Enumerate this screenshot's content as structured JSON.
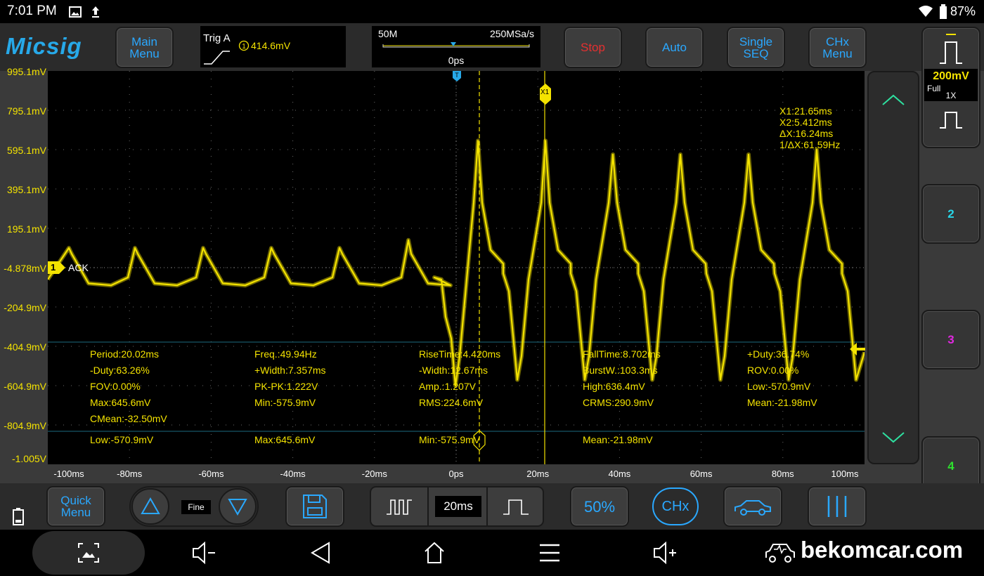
{
  "status": {
    "time": "7:01 PM",
    "battery": "87%"
  },
  "brand": "Micsig",
  "buttons": {
    "main_menu": [
      "Main",
      "Menu"
    ],
    "stop": "Stop",
    "auto": "Auto",
    "single_seq": [
      "Single",
      "SEQ"
    ],
    "chx_menu": [
      "CHx",
      "Menu"
    ],
    "quick_menu": [
      "Quick",
      "Menu"
    ],
    "fine": "Fine",
    "timebase": "20ms",
    "fifty_pct": "50%",
    "chx": "CHx"
  },
  "trigger": {
    "title": "Trig A",
    "level": "414.6mV"
  },
  "acquisition": {
    "memory": "50M",
    "sample_rate": "250MSa/s",
    "position": "0ps"
  },
  "channel": {
    "number": "1",
    "label": "ACK",
    "scale": "200mV",
    "bandwidth": "Full",
    "probe": "1X"
  },
  "side_channels": [
    "2",
    "3",
    "4"
  ],
  "colors": {
    "ch1": "#f4e300",
    "ch2": "#28d6e8",
    "ch3": "#e028e0",
    "ch4": "#2ee02e",
    "accent": "#2aa8ff"
  },
  "y_labels": [
    "995.1mV",
    "795.1mV",
    "595.1mV",
    "395.1mV",
    "195.1mV",
    "-4.878mV",
    "-204.9mV",
    "-404.9mV",
    "-604.9mV",
    "-804.9mV",
    "-1.005V"
  ],
  "x_labels": [
    "-100ms",
    "-80ms",
    "-60ms",
    "-40ms",
    "-20ms",
    "0ps",
    "20ms",
    "40ms",
    "60ms",
    "80ms",
    "100ms"
  ],
  "cursors": {
    "x1": "X1:21.65ms",
    "x2": "X2:5.412ms",
    "dx": "ΔX:16.24ms",
    "inv_dx": "1/ΔX:61.59Hz",
    "x1_tag": "X1"
  },
  "measurements": [
    [
      "Period:20.02ms",
      "-Duty:63.26%",
      "FOV:0.00%",
      "Max:645.6mV",
      "CMean:-32.50mV"
    ],
    [
      "Freq.:49.94Hz",
      "+Width:7.357ms",
      "PK-PK:1.222V",
      "Min:-575.9mV"
    ],
    [
      "RiseTime:4.420ms",
      "-Width:12.67ms",
      "Amp.:1.207V",
      "RMS:224.6mV"
    ],
    [
      "FallTime:8.702ms",
      "BurstW.:103.3ms",
      "High:636.4mV",
      "CRMS:290.9mV"
    ],
    [
      "+Duty:36.74%",
      "ROV:0.00%",
      "Low:-570.9mV",
      "Mean:-21.98mV"
    ]
  ],
  "stats_row": [
    "Low:-570.9mV",
    "Max:645.6mV",
    "Min:-575.9mV",
    "Mean:-21.98mV"
  ],
  "watermark": "bekomcar.com"
}
